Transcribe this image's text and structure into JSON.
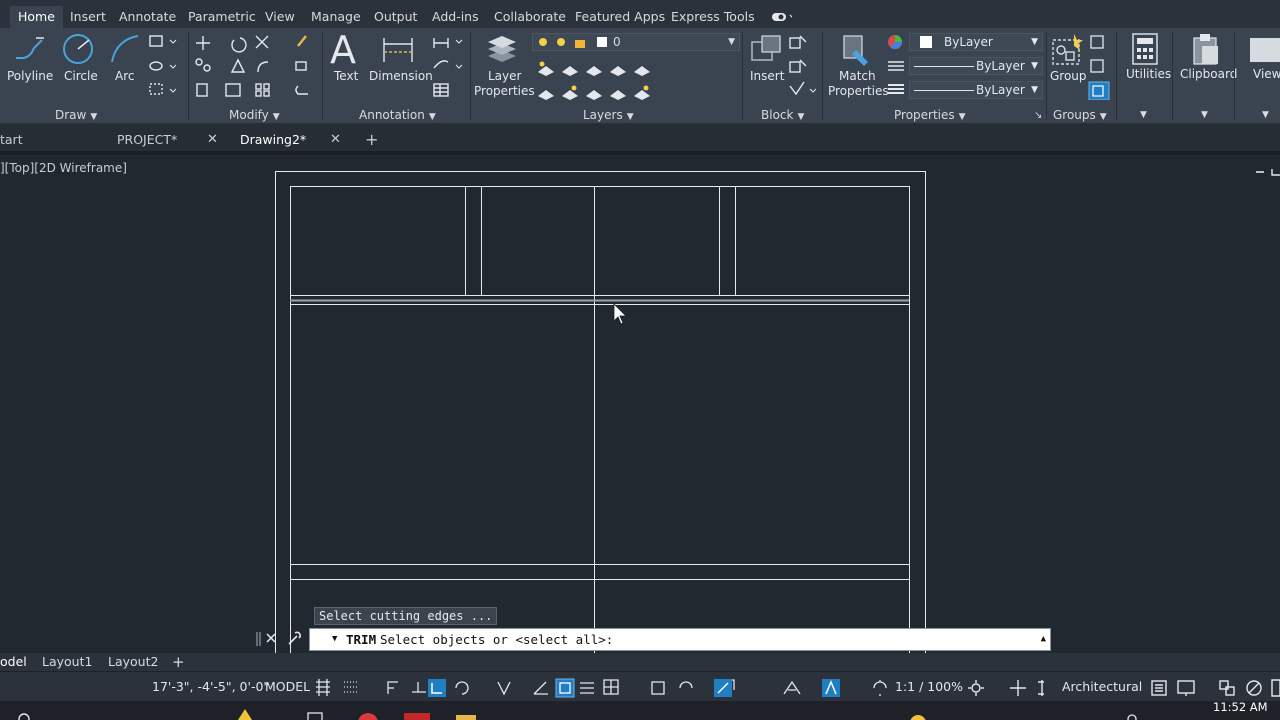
{
  "menu_tabs": [
    "Home",
    "Insert",
    "Annotate",
    "Parametric",
    "View",
    "Manage",
    "Output",
    "Add-ins",
    "Collaborate",
    "Featured Apps",
    "Express Tools"
  ],
  "ribbon": {
    "draw": {
      "polyline": "Polyline",
      "circle": "Circle",
      "arc": "Arc",
      "panel": "Draw"
    },
    "modify": {
      "panel": "Modify"
    },
    "annotation": {
      "text": "Text",
      "dimension": "Dimension",
      "panel": "Annotation"
    },
    "layers": {
      "layer_properties_line1": "Layer",
      "layer_properties_line2": "Properties",
      "current_layer": "0",
      "panel": "Layers"
    },
    "block": {
      "insert": "Insert",
      "panel": "Block"
    },
    "properties": {
      "match_line1": "Match",
      "match_line2": "Properties",
      "color": "ByLayer",
      "linetype": "ByLayer",
      "lineweight": "ByLayer",
      "panel": "Properties"
    },
    "groups": {
      "group": "Group",
      "panel": "Groups"
    },
    "utilities": "Utilities",
    "clipboard": "Clipboard",
    "view": "View"
  },
  "doc_tabs": [
    {
      "label": "tart"
    },
    {
      "label": "PROJECT*"
    },
    {
      "label": "Drawing2*"
    }
  ],
  "viewport_label": "][Top][2D Wireframe]",
  "command": {
    "tooltip": "Select cutting edges ...",
    "name": "TRIM",
    "prompt": "Select objects or <select all>:"
  },
  "layout_tabs": [
    "odel",
    "Layout1",
    "Layout2"
  ],
  "status": {
    "coordinates": "17'-3\", -4'-5\", 0'-0\"",
    "space": "MODEL",
    "scale": "1:1 / 100%",
    "units": "Architectural"
  },
  "clock": "11:52 AM",
  "colors": {
    "ribbon": "#3a4350",
    "canvas": "#212830",
    "accent_active": "#1f7fc2"
  }
}
